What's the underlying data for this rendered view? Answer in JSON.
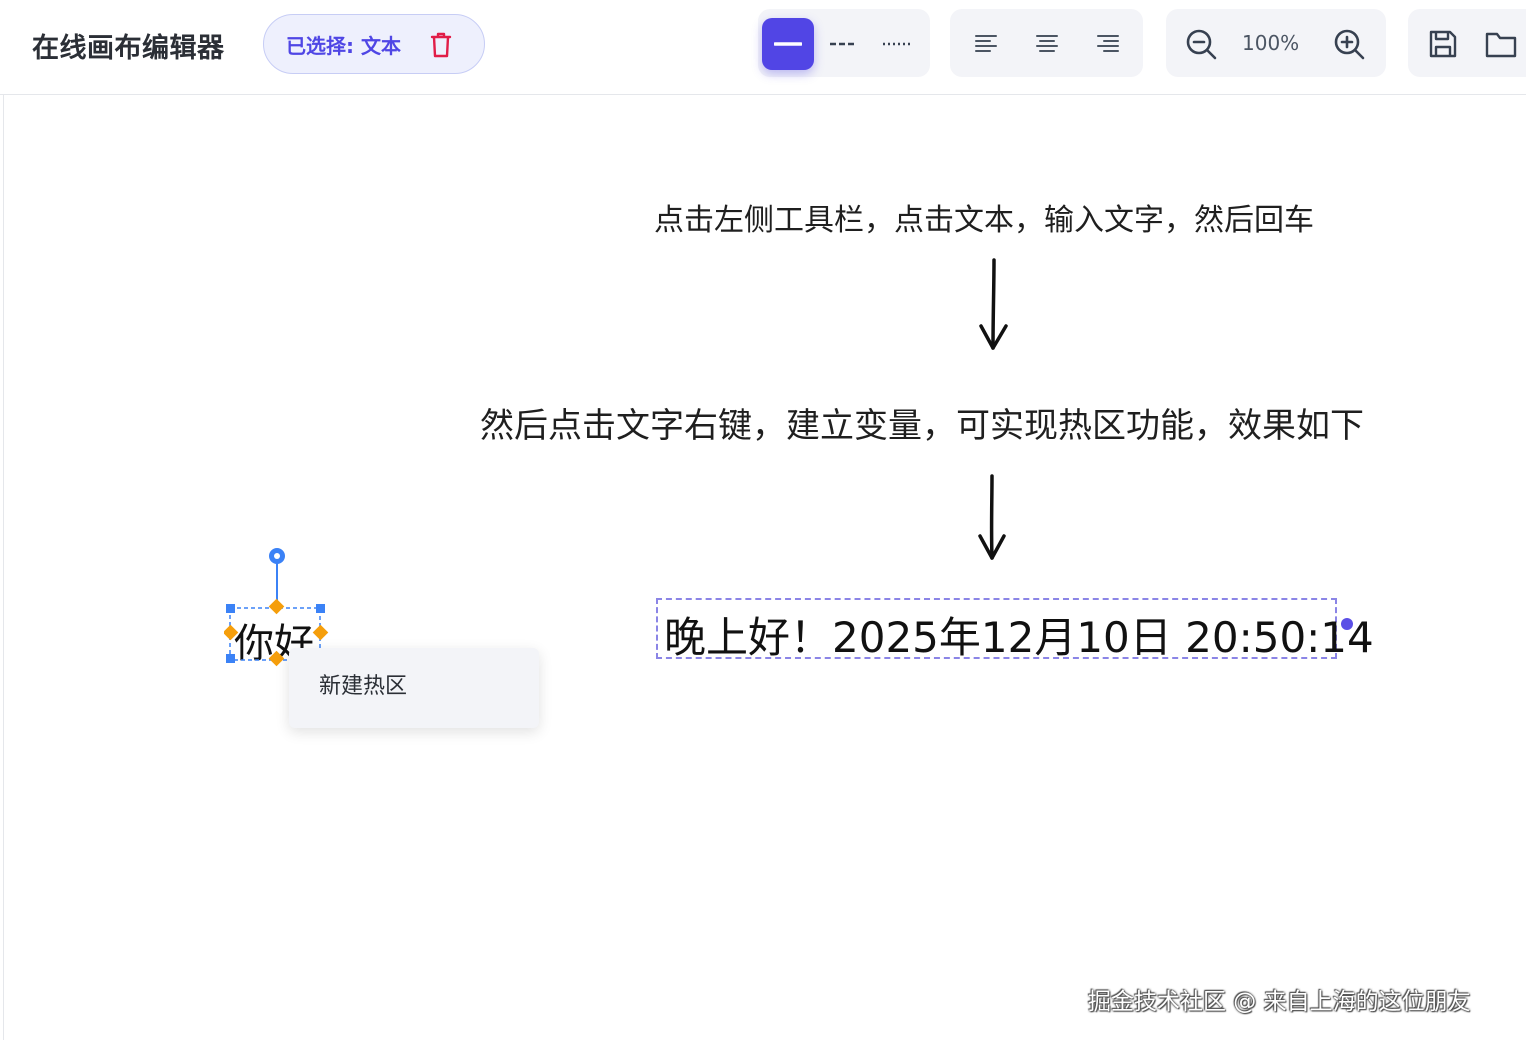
{
  "header": {
    "app_title": "在线画布编辑器",
    "selection_label": "已选择: 文本",
    "zoom_level": "100%"
  },
  "toolbar": {
    "line_styles": [
      "solid",
      "dashed",
      "dotted"
    ],
    "active_line_style": "solid",
    "align_options": [
      "left",
      "center",
      "right"
    ]
  },
  "canvas": {
    "step1_text": "点击左侧工具栏，点击文本，输入文字，然后回车",
    "step2_text": "然后点击文字右键，建立变量，可实现热区功能，效果如下",
    "greeting_text": "晚上好！2025年12月10日 20:50:14",
    "selected_text": "你好"
  },
  "context_menu": {
    "items": [
      {
        "label": "新建热区"
      }
    ]
  },
  "watermark": "掘金技术社区 @ 来自上海的这位朋友",
  "colors": {
    "accent": "#5145e5",
    "danger": "#e11d48",
    "selection_blue": "#3b82f6",
    "handle_orange": "#f59e0b"
  }
}
